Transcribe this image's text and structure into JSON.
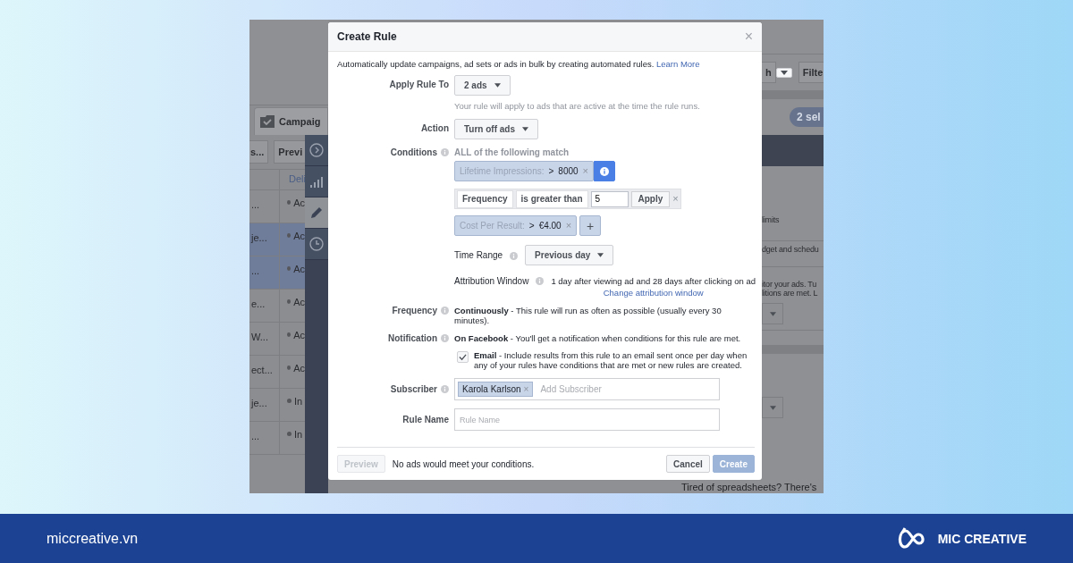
{
  "background_app": {
    "tab": "Campaig",
    "toolbar_left": [
      "s...",
      "Previ"
    ],
    "column_header": "Deli",
    "rows": [
      {
        "column_1": "...",
        "status": "Ac",
        "selected": false
      },
      {
        "column_1": "je...",
        "status": "Ac",
        "selected": true
      },
      {
        "column_1": "...",
        "status": "Ac",
        "selected": true
      },
      {
        "column_1": "e...",
        "status": "Ac",
        "selected": false
      },
      {
        "column_1": "W...",
        "status": "Ac",
        "selected": false
      },
      {
        "column_1": "ect...",
        "status": "Ac",
        "selected": false
      },
      {
        "column_1": "je...",
        "status": "In",
        "selected": false
      },
      {
        "column_1": "...",
        "status": "In",
        "selected": false
      }
    ],
    "toolbar_right": [
      "h",
      "Filte"
    ],
    "selection_badge": "2 sel",
    "panel_texts": [
      "limits",
      "dget and schedu",
      "itor your ads. Tu",
      "litions are met. L"
    ],
    "bottom_text": "Tired of spreadsheets? There's"
  },
  "dialog": {
    "title": "Create Rule",
    "close": "×",
    "intro": "Automatically update campaigns, ad sets or ads in bulk by creating automated rules.",
    "learn_more": "Learn More",
    "apply_rule_to": {
      "label": "Apply Rule To",
      "value": "2 ads",
      "hint": "Your rule will apply to ads that are active at the time the rule runs."
    },
    "action": {
      "label": "Action",
      "value": "Turn off ads"
    },
    "conditions": {
      "label": "Conditions",
      "match": "ALL of the following match",
      "items": [
        {
          "kind": "token",
          "metric": "Lifetime Impressions:",
          "operator": ">",
          "value": "8000",
          "remove": "×",
          "trailing": {
            "kind": "info"
          }
        },
        {
          "kind": "editor",
          "metric": "Frequency",
          "operator": "is greater than",
          "value": "5",
          "apply": "Apply",
          "remove": "×"
        },
        {
          "kind": "token",
          "metric": "Cost Per Result:",
          "operator": ">",
          "value": "€4.00",
          "remove": "×",
          "trailing": {
            "kind": "add",
            "label": "+"
          }
        }
      ]
    },
    "time_range": {
      "label": "Time Range",
      "value": "Previous day"
    },
    "attribution": {
      "label": "Attribution Window",
      "value": "1 day after viewing ad and 28 days after clicking on ad",
      "link": "Change attribution window"
    },
    "frequency": {
      "label": "Frequency",
      "text": "**Continuously** - This rule will run as often as possible (usually every 30 minutes)."
    },
    "notification": {
      "label": "Notification",
      "text": "**On Facebook** - You'll get a notification when conditions for this rule are met.",
      "email": {
        "checked": true,
        "text": "**Email** - Include results from this rule to an email sent once per day when any of your rules have conditions that are met or new rules are created."
      }
    },
    "subscriber": {
      "label": "Subscriber",
      "token": "Karola Karlson",
      "remove": "×",
      "placeholder": "Add Subscriber"
    },
    "rule_name": {
      "label": "Rule Name",
      "placeholder": "Rule Name"
    },
    "footer": {
      "preview": {
        "label": "Preview",
        "disabled": true
      },
      "message": "No ads would meet your conditions.",
      "cancel": "Cancel",
      "create": {
        "label": "Create",
        "disabled": true
      }
    }
  },
  "footer": {
    "site": "miccreative.vn",
    "brand": "MIC CREATIVE"
  }
}
